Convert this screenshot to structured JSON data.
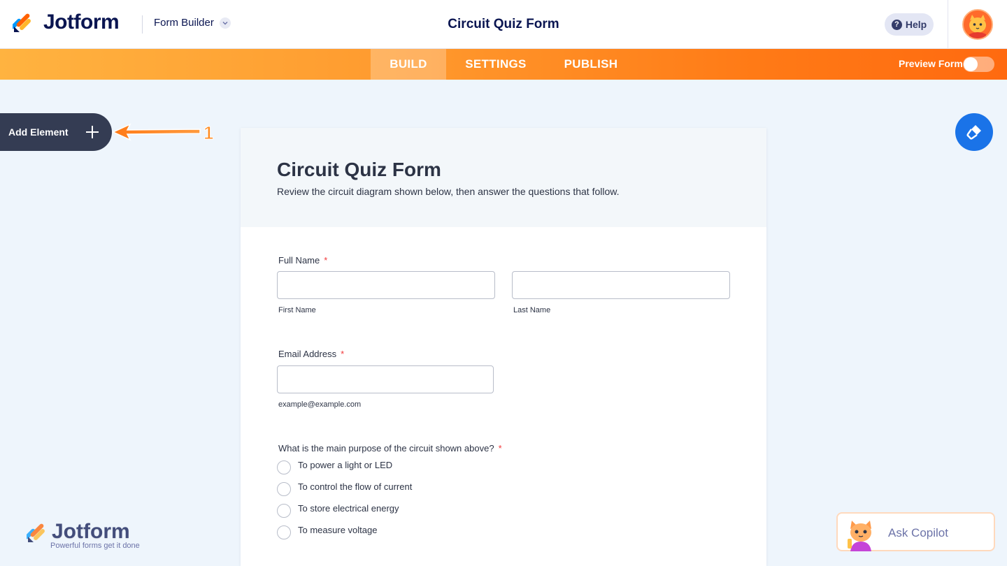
{
  "header": {
    "brand": "Jotform",
    "app_menu": "Form Builder",
    "title": "Circuit Quiz Form",
    "help_label": "Help"
  },
  "nav": {
    "tabs": [
      {
        "label": "BUILD",
        "active": true
      },
      {
        "label": "SETTINGS",
        "active": false
      },
      {
        "label": "PUBLISH",
        "active": false
      }
    ],
    "preview_label": "Preview Form",
    "preview_on": false
  },
  "sidebar": {
    "add_element_label": "Add Element",
    "annotation_number": "1"
  },
  "form": {
    "title": "Circuit Quiz Form",
    "subtitle": "Review the circuit diagram shown below, then answer the questions that follow.",
    "full_name": {
      "label": "Full Name",
      "required_mark": "*",
      "first_value": "",
      "last_value": "",
      "first_sublabel": "First Name",
      "last_sublabel": "Last Name"
    },
    "email": {
      "label": "Email Address",
      "required_mark": "*",
      "value": "",
      "sublabel": "example@example.com"
    },
    "question": {
      "label": "What is the main purpose of the circuit shown above?",
      "required_mark": "*",
      "options": [
        "To power a light or LED",
        "To control the flow of current",
        "To store electrical energy",
        "To measure voltage"
      ]
    }
  },
  "footer": {
    "brand": "Jotform",
    "tagline": "Powerful forms get it done"
  },
  "copilot": {
    "label": "Ask Copilot"
  },
  "colors": {
    "navy": "#0a1551",
    "orange_start": "#ffb340",
    "orange_end": "#ff6a10",
    "add_element_bg": "#343c53",
    "paint_button": "#1a73e8",
    "required": "#f23a3c",
    "canvas": "#eef5fc"
  }
}
